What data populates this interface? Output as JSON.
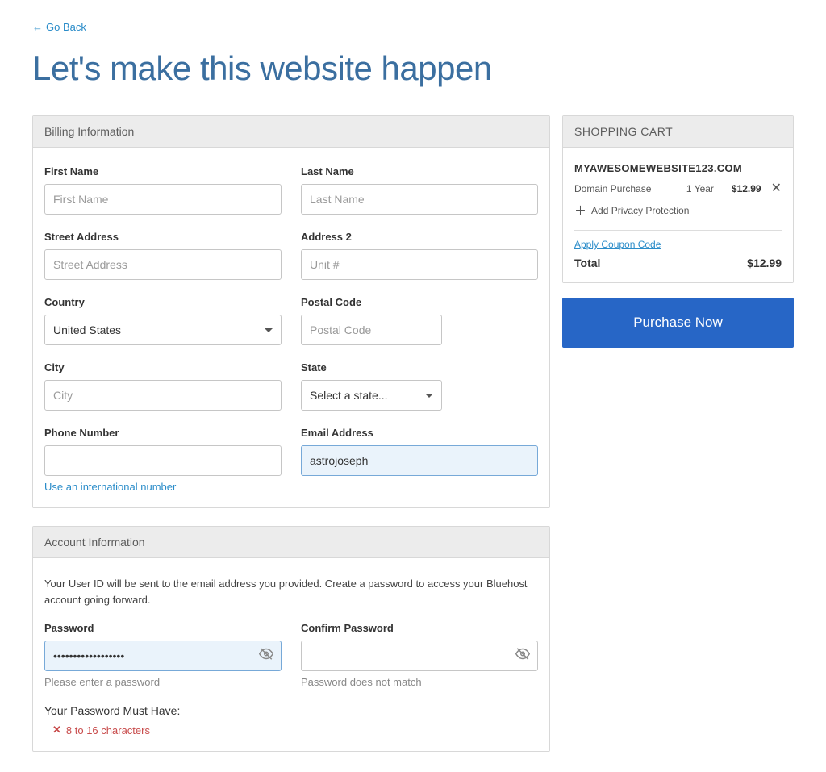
{
  "nav": {
    "go_back": "Go Back"
  },
  "page": {
    "title": "Let's make this website happen"
  },
  "billing": {
    "header": "Billing Information",
    "first_name_label": "First Name",
    "first_name_placeholder": "First Name",
    "first_name_value": "",
    "last_name_label": "Last Name",
    "last_name_placeholder": "Last Name",
    "last_name_value": "",
    "street_label": "Street Address",
    "street_placeholder": "Street Address",
    "street_value": "",
    "address2_label": "Address 2",
    "address2_placeholder": "Unit #",
    "address2_value": "",
    "country_label": "Country",
    "country_value": "United States",
    "postal_label": "Postal Code",
    "postal_placeholder": "Postal Code",
    "postal_value": "",
    "city_label": "City",
    "city_placeholder": "City",
    "city_value": "",
    "state_label": "State",
    "state_value": "Select a state...",
    "phone_label": "Phone Number",
    "phone_value": "",
    "intl_link": "Use an international number",
    "email_label": "Email Address",
    "email_value": "astrojoseph"
  },
  "account": {
    "header": "Account Information",
    "intro": "Your User ID will be sent to the email address you provided. Create a password to access your Bluehost account going forward.",
    "password_label": "Password",
    "password_value": "••••••••••••••••••",
    "password_help": "Please enter a password",
    "confirm_label": "Confirm Password",
    "confirm_value": "",
    "confirm_help": "Password does not match",
    "must_have": "Your Password Must Have:",
    "rules": [
      "8 to 16 characters"
    ]
  },
  "cart": {
    "header": "SHOPPING CART",
    "domain": "MYAWESOMEWEBSITE123.COM",
    "items": [
      {
        "name": "Domain Purchase",
        "duration": "1 Year",
        "price": "$12.99"
      }
    ],
    "add_privacy": "Add Privacy Protection",
    "coupon_link": "Apply Coupon Code",
    "total_label": "Total",
    "total_value": "$12.99",
    "purchase_btn": "Purchase Now"
  }
}
